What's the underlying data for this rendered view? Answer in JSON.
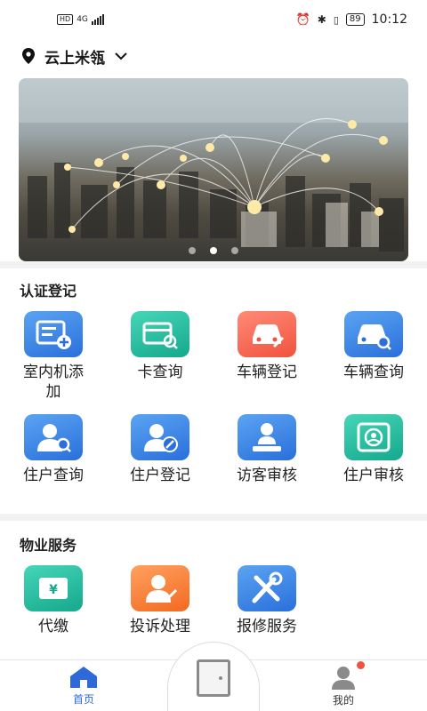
{
  "status_bar": {
    "network": "4G",
    "hd": "HD",
    "battery": "89",
    "time": "10:12"
  },
  "location": {
    "name": "云上米瓴"
  },
  "banner": {
    "pages": 3,
    "active_page": 2
  },
  "section_auth": {
    "title": "认证登记",
    "items": [
      {
        "label": "室内机添加",
        "icon": "intercom-add-icon",
        "color": "blue"
      },
      {
        "label": "卡查询",
        "icon": "card-search-icon",
        "color": "teal"
      },
      {
        "label": "车辆登记",
        "icon": "car-register-icon",
        "color": "red"
      },
      {
        "label": "车辆查询",
        "icon": "car-search-icon",
        "color": "blue"
      },
      {
        "label": "住户查询",
        "icon": "resident-search-icon",
        "color": "blue"
      },
      {
        "label": "住户登记",
        "icon": "resident-register-icon",
        "color": "blue"
      },
      {
        "label": "访客审核",
        "icon": "visitor-review-icon",
        "color": "blue"
      },
      {
        "label": "住户审核",
        "icon": "resident-review-icon",
        "color": "teal"
      }
    ]
  },
  "section_property": {
    "title": "物业服务",
    "items": [
      {
        "label": "代缴",
        "icon": "payment-icon",
        "color": "teal"
      },
      {
        "label": "投诉处理",
        "icon": "complaint-icon",
        "color": "orange"
      },
      {
        "label": "报修服务",
        "icon": "repair-tools-icon",
        "color": "blue"
      }
    ]
  },
  "tabbar": {
    "home_label": "首页",
    "mine_label": "我的"
  },
  "colors": {
    "accent": "#2d6ad8",
    "badge": "#f0533d"
  }
}
